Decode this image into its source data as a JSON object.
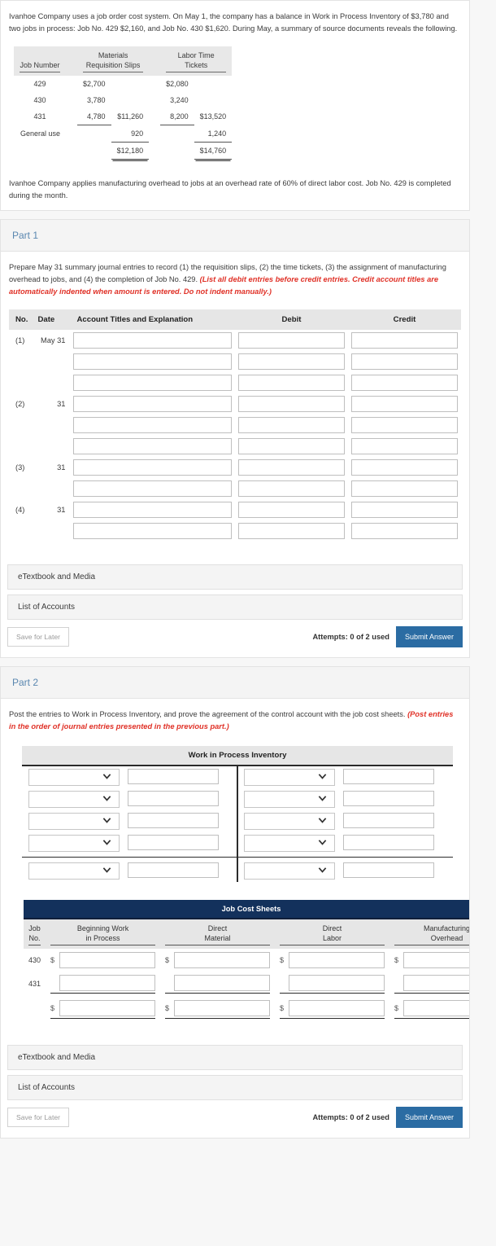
{
  "intro": {
    "paragraph1": "Ivanhoe Company uses a job order cost system. On May 1, the company has a balance in Work in Process Inventory of $3,780 and two jobs in process: Job No. 429 $2,160, and Job No. 430 $1,620. During May, a summary of source documents reveals the following.",
    "paragraph2": "Ivanhoe Company applies manufacturing overhead to jobs at an overhead rate of 60% of direct labor cost. Job No. 429 is completed during the month."
  },
  "source_table": {
    "headers": {
      "job_number": "Job Number",
      "materials_line1": "Materials",
      "materials_line2": "Requisition Slips",
      "labor_line1": "Labor Time",
      "labor_line2": "Tickets"
    },
    "rows": [
      {
        "job": "429",
        "materials": "$2,700",
        "materials_total": "",
        "labor": "$2,080",
        "labor_total": ""
      },
      {
        "job": "430",
        "materials": "3,780",
        "materials_total": "",
        "labor": "3,240",
        "labor_total": ""
      },
      {
        "job": "431",
        "materials": "4,780",
        "materials_total": "$11,260",
        "labor": "8,200",
        "labor_total": "$13,520"
      },
      {
        "job": "General use",
        "materials": "",
        "materials_total": "920",
        "labor": "",
        "labor_total": "1,240"
      },
      {
        "job": "",
        "materials": "",
        "materials_total": "$12,180",
        "labor": "",
        "labor_total": "$14,760"
      }
    ]
  },
  "part1": {
    "title": "Part 1",
    "instruction_plain": "Prepare May 31 summary journal entries to record (1) the requisition slips, (2) the time tickets, (3) the assignment of manufacturing overhead to jobs, and (4) the completion of Job No. 429. ",
    "instruction_italic": "(List all debit entries before credit entries. Credit account titles are automatically indented when amount is entered. Do not indent manually.)",
    "table": {
      "headers": {
        "no": "No.",
        "date": "Date",
        "account": "Account Titles and Explanation",
        "debit": "Debit",
        "credit": "Credit"
      },
      "rows": [
        {
          "no": "(1)",
          "date": "May 31",
          "account": "",
          "debit": "",
          "credit": ""
        },
        {
          "no": "",
          "date": "",
          "account": "",
          "debit": "",
          "credit": ""
        },
        {
          "no": "",
          "date": "",
          "account": "",
          "debit": "",
          "credit": ""
        },
        {
          "no": "(2)",
          "date": "31",
          "account": "",
          "debit": "",
          "credit": ""
        },
        {
          "no": "",
          "date": "",
          "account": "",
          "debit": "",
          "credit": ""
        },
        {
          "no": "",
          "date": "",
          "account": "",
          "debit": "",
          "credit": ""
        },
        {
          "no": "(3)",
          "date": "31",
          "account": "",
          "debit": "",
          "credit": ""
        },
        {
          "no": "",
          "date": "",
          "account": "",
          "debit": "",
          "credit": ""
        },
        {
          "no": "(4)",
          "date": "31",
          "account": "",
          "debit": "",
          "credit": ""
        },
        {
          "no": "",
          "date": "",
          "account": "",
          "debit": "",
          "credit": ""
        }
      ]
    },
    "etextbook_label": "eTextbook and Media",
    "list_of_accounts_label": "List of Accounts",
    "save_label": "Save for Later",
    "attempts_label": "Attempts: 0 of 2 used",
    "submit_label": "Submit Answer"
  },
  "part2": {
    "title": "Part 2",
    "instruction_plain": "Post the entries to Work in Process Inventory, and prove the agreement of the control account with the job cost sheets. ",
    "instruction_italic": "(Post entries in the order of journal entries presented in the previous part.)",
    "taccount": {
      "title": "Work in Process Inventory",
      "rows": [
        {
          "left_select": "",
          "left_amount": "",
          "right_select": "",
          "right_amount": ""
        },
        {
          "left_select": "",
          "left_amount": "",
          "right_select": "",
          "right_amount": ""
        },
        {
          "left_select": "",
          "left_amount": "",
          "right_select": "",
          "right_amount": ""
        },
        {
          "left_select": "",
          "left_amount": "",
          "right_select": "",
          "right_amount": ""
        }
      ],
      "balance_row": {
        "left_select": "",
        "left_amount": "",
        "right_select": "",
        "right_amount": ""
      }
    },
    "job_cost_sheets": {
      "title": "Job Cost Sheets",
      "headers": {
        "job_no_line1": "Job",
        "job_no_line2": "No.",
        "beginning_line1": "Beginning Work",
        "beginning_line2": "in Process",
        "direct_material_line1": "Direct",
        "direct_material_line2": "Material",
        "direct_labor_line1": "Direct",
        "direct_labor_line2": "Labor",
        "overhead_line1": "Manufacturing",
        "overhead_line2": "Overhead"
      },
      "rows": [
        {
          "job": "430",
          "dollar": "$",
          "beginning": "",
          "material": "",
          "labor": "",
          "overhead": ""
        },
        {
          "job": "431",
          "dollar": "",
          "beginning": "",
          "material": "",
          "labor": "",
          "overhead": ""
        },
        {
          "job": "",
          "dollar": "$",
          "beginning": "",
          "material": "",
          "labor": "",
          "overhead": ""
        }
      ]
    },
    "etextbook_label": "eTextbook and Media",
    "list_of_accounts_label": "List of Accounts",
    "save_label": "Save for Later",
    "attempts_label": "Attempts: 0 of 2 used",
    "submit_label": "Submit Answer"
  },
  "colors": {
    "part_heading": "#5a87b0",
    "submit_blue": "#2b6ca3",
    "jcs_navy": "#13315c",
    "red_italic": "#e03127"
  }
}
